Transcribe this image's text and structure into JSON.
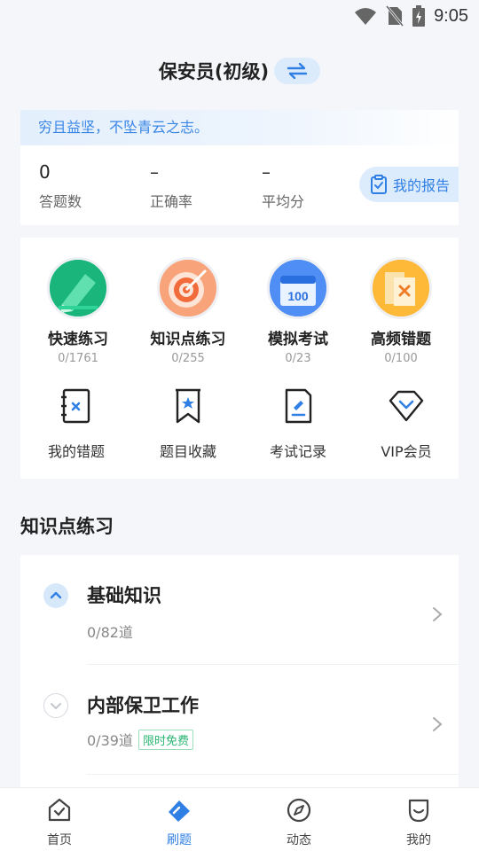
{
  "status_bar": {
    "time": "9:05",
    "icons": [
      "wifi-icon",
      "no-sim-icon",
      "battery-charging-icon"
    ]
  },
  "header": {
    "title": "保安员(初级)",
    "switch_icon": "swap-arrows-icon"
  },
  "quote": "穷且益坚，不坠青云之志。",
  "stats": [
    {
      "value": "0",
      "label": "答题数"
    },
    {
      "value": "–",
      "label": "正确率"
    },
    {
      "value": "–",
      "label": "平均分"
    }
  ],
  "report_button": {
    "label": "我的报告",
    "icon": "clipboard-check-icon"
  },
  "practice_modes": [
    {
      "name": "快速练习",
      "count": "0/1761",
      "icon": "pencil-icon",
      "color": "#1fbf86"
    },
    {
      "name": "知识点练习",
      "count": "0/255",
      "icon": "target-icon",
      "color": "#f26b3a"
    },
    {
      "name": "模拟考试",
      "count": "0/23",
      "icon": "calendar-100-icon",
      "color": "#3d7ff0"
    },
    {
      "name": "高频错题",
      "count": "0/100",
      "icon": "wrong-book-icon",
      "color": "#ffae21"
    }
  ],
  "tools": [
    {
      "name": "我的错题",
      "icon": "wrong-notebook-icon"
    },
    {
      "name": "题目收藏",
      "icon": "bookmark-star-icon"
    },
    {
      "name": "考试记录",
      "icon": "exam-record-icon"
    },
    {
      "name": "VIP会员",
      "icon": "diamond-icon"
    }
  ],
  "section_title": "知识点练习",
  "knowledge_items": [
    {
      "name": "基础知识",
      "progress": "0/82道",
      "badge": "",
      "expanded": true
    },
    {
      "name": "内部保卫工作",
      "progress": "0/39道",
      "badge": "限时免费",
      "expanded": false
    }
  ],
  "bottom_nav": [
    {
      "label": "首页",
      "icon": "home-check-icon",
      "active": false
    },
    {
      "label": "刷题",
      "icon": "pencil-tag-icon",
      "active": true
    },
    {
      "label": "动态",
      "icon": "compass-icon",
      "active": false
    },
    {
      "label": "我的",
      "icon": "profile-icon",
      "active": false
    }
  ],
  "colors": {
    "accent": "#2f7fe5",
    "badge_green": "#2bb673",
    "background": "#f4f6fa"
  }
}
